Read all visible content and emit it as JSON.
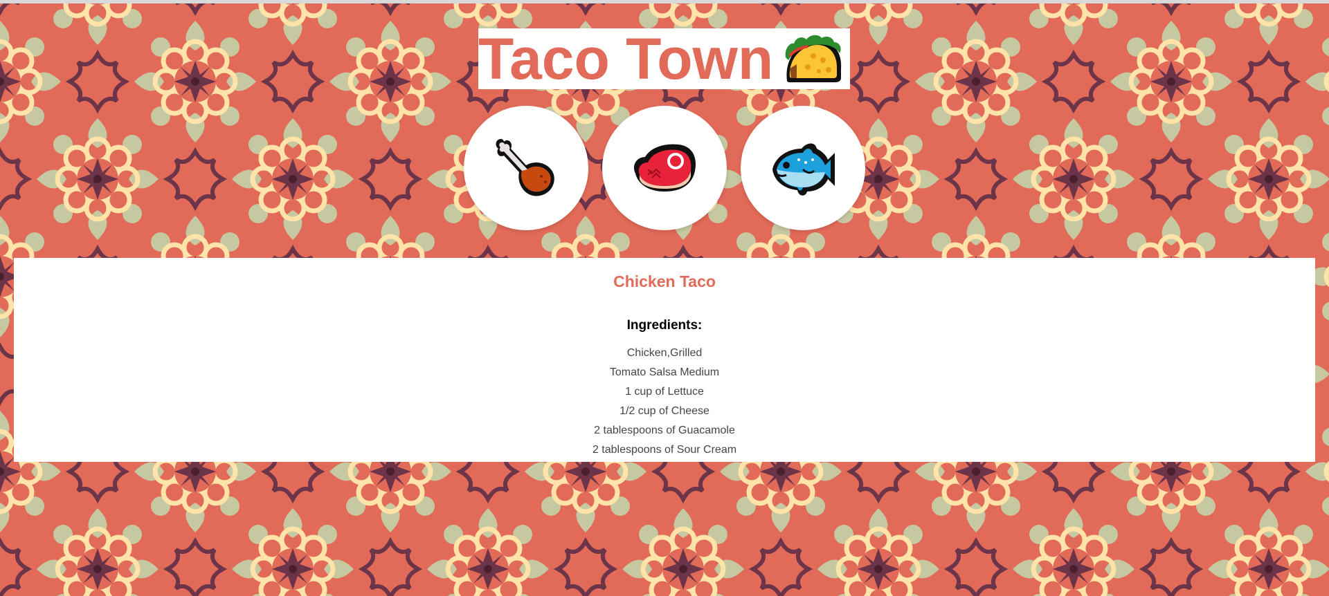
{
  "header": {
    "title": "Taco Town",
    "logo_icon": "taco-icon"
  },
  "protein_buttons": [
    {
      "icon": "poultry-leg-icon"
    },
    {
      "icon": "meat-cut-icon"
    },
    {
      "icon": "fish-icon"
    }
  ],
  "recipe": {
    "name": "Chicken Taco",
    "ingredients_heading": "Ingredients:",
    "ingredients": [
      "Chicken,Grilled",
      "Tomato Salsa Medium",
      "1 cup of Lettuce",
      "1/2 cup of Cheese",
      "2 tablespoons of Guacamole",
      "2 tablespoons of Sour Cream"
    ]
  },
  "colors": {
    "background": "#E26A58",
    "accent": "#E26A58",
    "pattern_dark": "#6B3448",
    "pattern_cream": "#FFE3A8",
    "pattern_sage": "#C6C8A2",
    "card": "#FFFFFF"
  }
}
